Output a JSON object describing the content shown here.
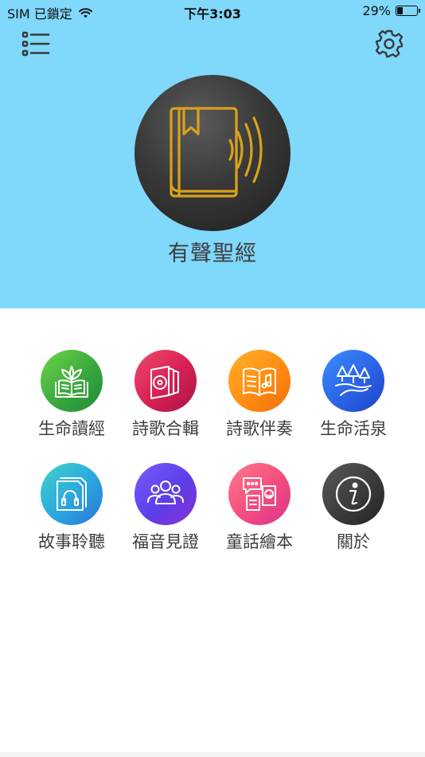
{
  "status_bar": {
    "carrier": "SIM 已鎖定",
    "time": "下午3:03",
    "battery_percent_text": "29%",
    "battery_level": 0.29,
    "wifi_icon": "wifi-icon",
    "battery_icon": "battery-icon"
  },
  "header": {
    "background_color": "#80d8fb",
    "menu_icon": "list-icon",
    "settings_icon": "gear-icon",
    "logo_icon": "audio-book-icon",
    "logo_accent_color": "#d9a21b",
    "title": "有聲聖經"
  },
  "menu": [
    {
      "label": "生命讀經",
      "icon": "open-book-plant-icon",
      "color": "#3aa83c"
    },
    {
      "label": "詩歌合輯",
      "icon": "music-album-icon",
      "color": "#d61f52"
    },
    {
      "label": "詩歌伴奏",
      "icon": "songbook-note-icon",
      "color": "#ff8c12"
    },
    {
      "label": "生命活泉",
      "icon": "trees-river-icon",
      "color": "#2b63e6"
    },
    {
      "label": "故事聆聽",
      "icon": "headphones-book-icon",
      "color": "#2aa6e0"
    },
    {
      "label": "福音見證",
      "icon": "group-people-icon",
      "color": "#5b3ee8"
    },
    {
      "label": "童話繪本",
      "icon": "chat-bubbles-icon",
      "color": "#f44b7e"
    },
    {
      "label": "關於",
      "icon": "info-icon",
      "color": "#3b3b3b"
    }
  ]
}
